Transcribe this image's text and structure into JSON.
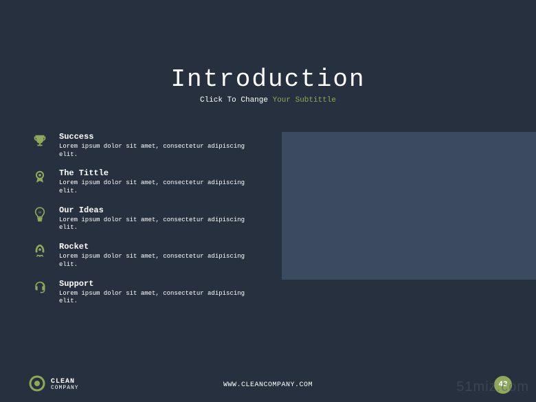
{
  "title": "Introduction",
  "subtitle_prefix": "Click To Change ",
  "subtitle_highlight": "Your Subtittle",
  "items": [
    {
      "title": "Success",
      "desc": "Lorem ipsum dolor sit amet, consectetur adipiscing elit."
    },
    {
      "title": "The Tittle",
      "desc": "Lorem ipsum dolor sit amet, consectetur adipiscing elit."
    },
    {
      "title": "Our Ideas",
      "desc": "Lorem ipsum dolor sit amet, consectetur adipiscing elit."
    },
    {
      "title": "Rocket",
      "desc": "Lorem ipsum dolor sit amet, consectetur adipiscing elit."
    },
    {
      "title": "Support",
      "desc": "Lorem ipsum dolor sit amet, consectetur adipiscing elit."
    }
  ],
  "footer": {
    "logo_line1": "CLEAN",
    "logo_line2": "COMPANY",
    "url": "WWW.CLEANCOMPANY.COM",
    "page": "43"
  },
  "watermark": "51miz.com",
  "colors": {
    "accent": "#8fa859",
    "bg": "#27303e",
    "placeholder": "#3b4a5e"
  }
}
